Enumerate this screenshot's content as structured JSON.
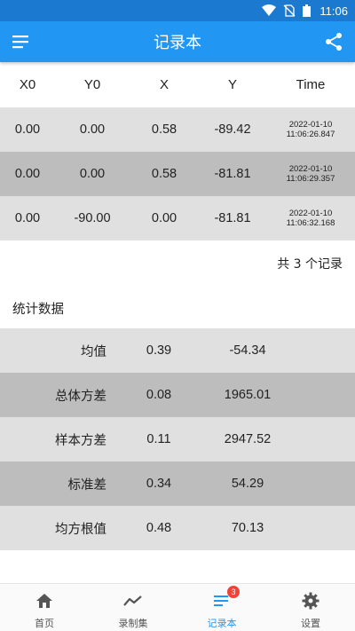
{
  "status_bar": {
    "time": "11:06"
  },
  "app_bar": {
    "title": "记录本",
    "menu_icon": "menu-icon",
    "share_icon": "share-icon"
  },
  "colors": {
    "primary": "#2196f3",
    "status_bar": "#1b7ad0",
    "row_light": "#e0e0e0",
    "row_dark": "#bdbdbd",
    "badge": "#f44336"
  },
  "table": {
    "headers": [
      "X0",
      "Y0",
      "X",
      "Y",
      "Time"
    ],
    "rows": [
      {
        "x0": "0.00",
        "y0": "0.00",
        "x": "0.58",
        "y": "-89.42",
        "date": "2022-01-10",
        "time": "11:06:26.847"
      },
      {
        "x0": "0.00",
        "y0": "0.00",
        "x": "0.58",
        "y": "-81.81",
        "date": "2022-01-10",
        "time": "11:06:29.357"
      },
      {
        "x0": "0.00",
        "y0": "-90.00",
        "x": "0.00",
        "y": "-81.81",
        "date": "2022-01-10",
        "time": "11:06:32.168"
      }
    ],
    "count_text": "共 3 个记录"
  },
  "stats": {
    "title": "统计数据",
    "rows": [
      {
        "label": "均值",
        "v1": "0.39",
        "v2": "-54.34"
      },
      {
        "label": "总体方差",
        "v1": "0.08",
        "v2": "1965.01"
      },
      {
        "label": "样本方差",
        "v1": "0.11",
        "v2": "2947.52"
      },
      {
        "label": "标准差",
        "v1": "0.34",
        "v2": "54.29"
      },
      {
        "label": "均方根值",
        "v1": "0.48",
        "v2": "70.13"
      }
    ]
  },
  "bottom_nav": {
    "items": [
      {
        "label": "首页",
        "icon": "home-icon"
      },
      {
        "label": "录制集",
        "icon": "trend-icon"
      },
      {
        "label": "记录本",
        "icon": "list-icon",
        "badge": "3",
        "active": true
      },
      {
        "label": "设置",
        "icon": "gear-icon"
      }
    ]
  }
}
